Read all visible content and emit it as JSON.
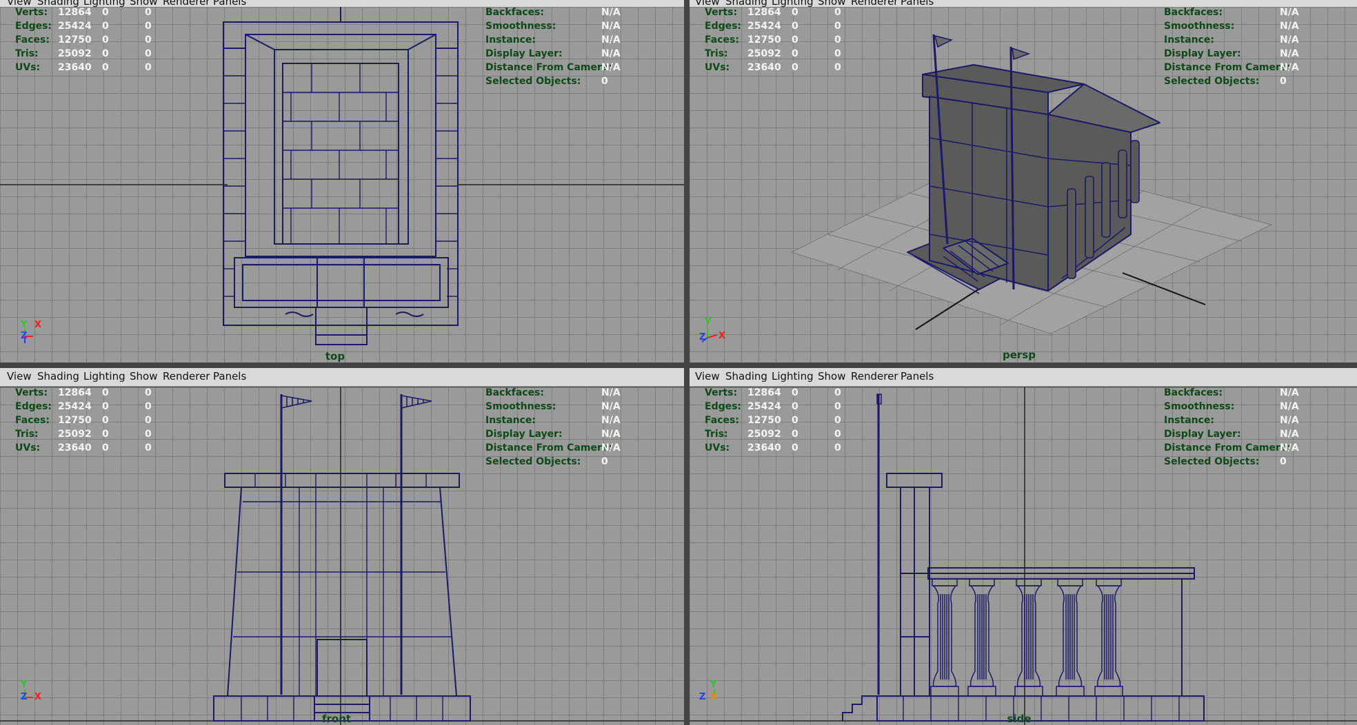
{
  "menu": [
    "View",
    "Shading",
    "Lighting",
    "Show",
    "Renderer",
    "Panels"
  ],
  "hud_stats": [
    {
      "label": "Verts:",
      "value": "12864",
      "sel1": "0",
      "sel2": "0"
    },
    {
      "label": "Edges:",
      "value": "25424",
      "sel1": "0",
      "sel2": "0"
    },
    {
      "label": "Faces:",
      "value": "12750",
      "sel1": "0",
      "sel2": "0"
    },
    {
      "label": "Tris:",
      "value": "25092",
      "sel1": "0",
      "sel2": "0"
    },
    {
      "label": "UVs:",
      "value": "23640",
      "sel1": "0",
      "sel2": "0"
    }
  ],
  "hud_info": [
    {
      "label": "Backfaces:",
      "value": "N/A"
    },
    {
      "label": "Smoothness:",
      "value": "N/A"
    },
    {
      "label": "Instance:",
      "value": "N/A"
    },
    {
      "label": "Display Layer:",
      "value": "N/A"
    },
    {
      "label": "Distance From Camera:",
      "value": "N/A"
    },
    {
      "label": "Selected Objects:",
      "value": "0"
    }
  ],
  "viewports": [
    {
      "camera": "top",
      "axes": [
        "Y",
        "X",
        "Z"
      ]
    },
    {
      "camera": "persp",
      "axes": [
        "Y",
        "Z",
        "X"
      ]
    },
    {
      "camera": "front",
      "axes": [
        "Y",
        "Z",
        "X"
      ]
    },
    {
      "camera": "side",
      "axes": [
        "Y",
        "Z",
        "X"
      ]
    }
  ],
  "colors": {
    "viewport_bg": "#9a9a9a",
    "wireframe": "#1a1a66",
    "hud_label": "#0d4a18",
    "hud_value": "#f4f4f4",
    "menubar": "#d9d9d9"
  }
}
